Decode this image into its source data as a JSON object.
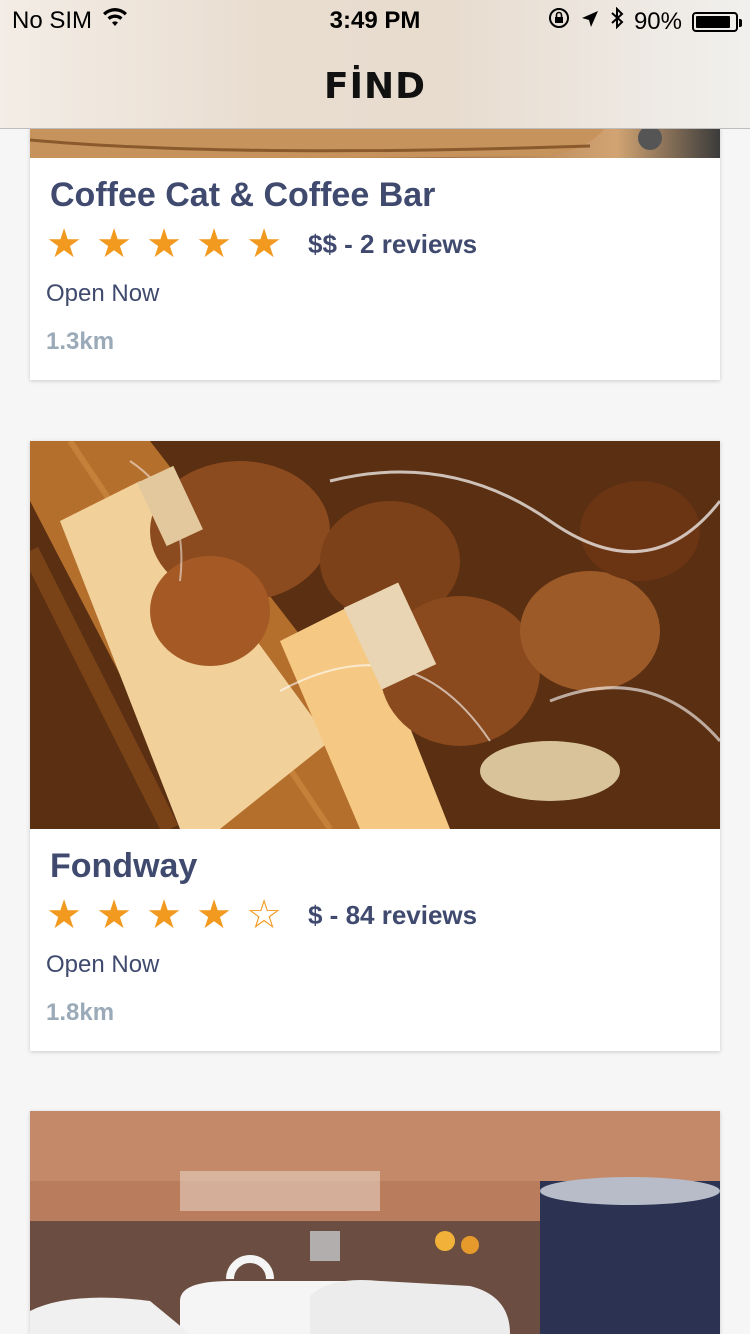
{
  "status_bar": {
    "carrier": "No SIM",
    "time": "3:49 PM",
    "battery_percent": "90%",
    "battery_level": 0.9
  },
  "header": {
    "title": "FİND"
  },
  "colors": {
    "accent_star": "#f29a1f",
    "text_primary": "#3f4a6e",
    "text_muted": "#9aaab8"
  },
  "listings": [
    {
      "name": "Coffee Cat & Coffee Bar",
      "rating": 5,
      "price_reviews": "$$ - 2 reviews",
      "status": "Open Now",
      "distance": "1.3km"
    },
    {
      "name": "Fondway",
      "rating": 4,
      "price_reviews": "$ - 84 reviews",
      "status": "Open Now",
      "distance": "1.8km"
    }
  ]
}
